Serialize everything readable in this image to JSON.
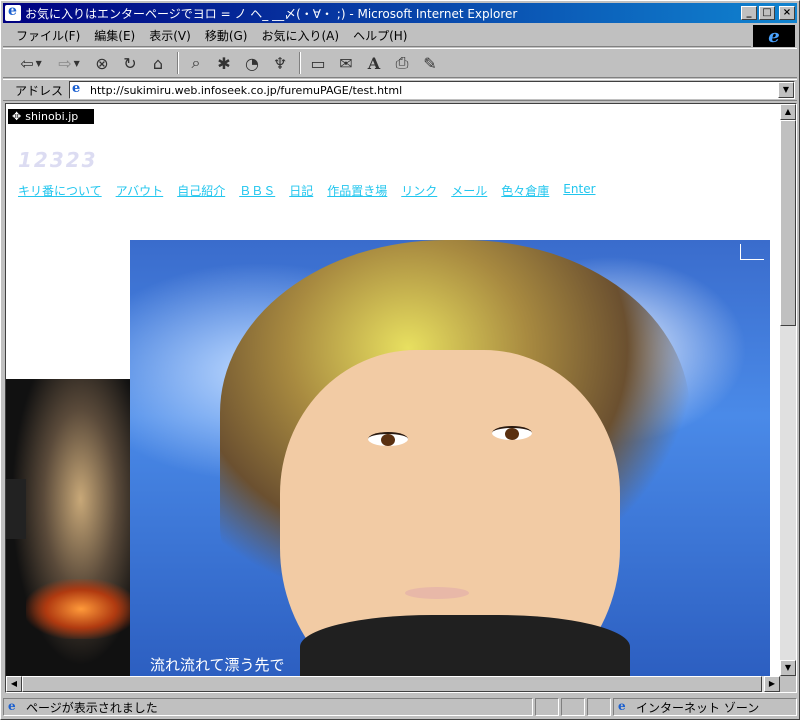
{
  "window": {
    "title": "お気に入りはエンターページでヨロ = ノ ヘ_ __〆(・∀・ ;) - Microsoft Internet Explorer",
    "btn_min": "_",
    "btn_max": "□",
    "btn_close": "×"
  },
  "menu": {
    "items": [
      "ファイル(F)",
      "編集(E)",
      "表示(V)",
      "移動(G)",
      "お気に入り(A)",
      "ヘルプ(H)"
    ]
  },
  "toolbar": {
    "icons": [
      "back-icon",
      "forward-icon",
      "stop-icon",
      "refresh-icon",
      "home-icon",
      "search-icon",
      "favorites-icon",
      "history-icon",
      "channels-icon",
      "fullscreen-icon",
      "mail-icon",
      "font-icon",
      "print-icon",
      "edit-icon"
    ]
  },
  "address": {
    "label": "アドレス",
    "url": "http://sukimiru.web.infoseek.co.jp/furemuPAGE/test.html"
  },
  "page": {
    "badge": "shinobi.jp",
    "counter": "12323",
    "nav": [
      "キリ番について",
      "アバウト",
      "自己紹介",
      "ＢＢＳ",
      "日記",
      "作品置き場",
      "リンク",
      "メール",
      "色々倉庫",
      "Enter"
    ],
    "caption": "流れ流れて漂う先で"
  },
  "status": {
    "text": "ページが表示されました",
    "zone": "インターネット ゾーン"
  },
  "colors": {
    "title_bar_start": "#000080",
    "link": "#22c6ee",
    "counter": "#dcdcf2"
  }
}
